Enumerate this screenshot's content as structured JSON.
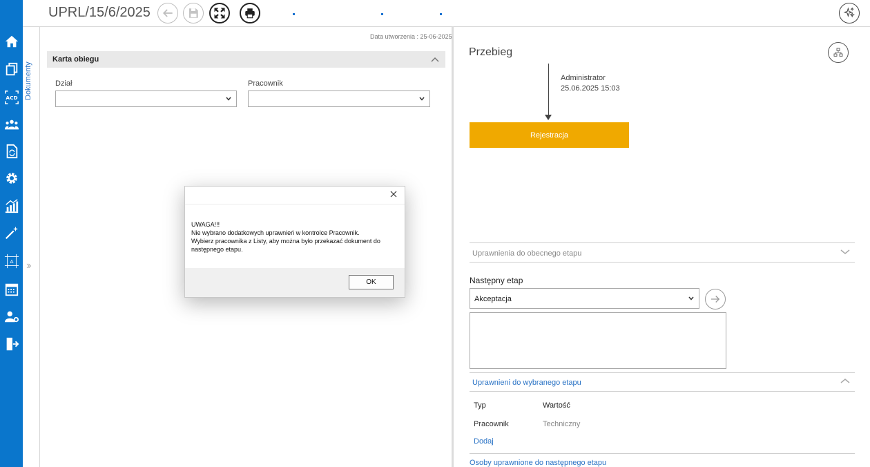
{
  "toolbar": {
    "doc_number": "UPRL/15/6/2025"
  },
  "sidebar": {
    "tab_label": "Dokumenty",
    "icons": [
      "home-icon",
      "documents-icon",
      "acd-icon",
      "users-icon",
      "document-refresh-icon",
      "gear-icon",
      "analytics-icon",
      "wand-icon",
      "layout-icon",
      "calendar-icon",
      "user-settings-icon",
      "logout-icon"
    ]
  },
  "left_panel": {
    "created_date": "Data utworzenia : 25-06-2025",
    "section_title": "Karta obiegu",
    "dzial_label": "Dział",
    "dzial_value": "",
    "pracownik_label": "Pracownik",
    "pracownik_value": ""
  },
  "right_panel": {
    "title": "Przebieg",
    "flow_user": "Administrator",
    "flow_date": "25.06.2025 15:03",
    "stage": "Rejestracja",
    "stage_color": "#f0a900",
    "current_stage_permissions": "Uprawnienia do obecnego etapu",
    "next_stage_label": "Następny etap",
    "next_stage_value": "Akceptacja",
    "note_value": "",
    "selected_stage_permissions": "Uprawnieni do wybranego etapu",
    "table": {
      "col_type": "Typ",
      "col_value": "Wartość",
      "rows": [
        {
          "type": "Pracownik",
          "value": "Techniczny"
        }
      ]
    },
    "add_link": "Dodaj",
    "next_persons": "Osoby uprawnione do następnego etapu"
  },
  "dialog": {
    "lines": [
      "UWAGA!!!",
      "Nie wybrano dodatkowych uprawnień w kontrolce Pracownik.",
      "Wybierz pracownika z Listy, aby można było przekazać dokument do",
      "następnego etapu."
    ],
    "ok_label": "OK"
  },
  "colors": {
    "rail": "#0a76cc",
    "accent": "#2a73c5"
  }
}
